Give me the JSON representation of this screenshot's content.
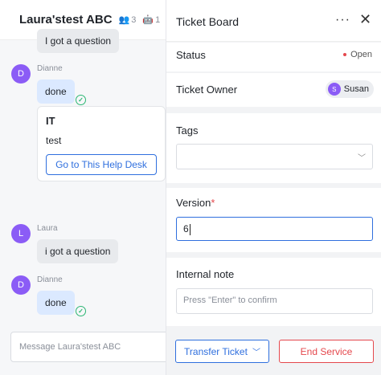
{
  "chat": {
    "title": "Laura'stest ABC",
    "members_count": "3",
    "bots_count": "1",
    "messages": [
      {
        "sender": "",
        "text": "I got a question"
      },
      {
        "sender": "Dianne",
        "initial": "D",
        "text": "done"
      },
      {
        "card_title": "IT",
        "card_body": "test",
        "card_button": "Go to This Help Desk"
      },
      {
        "sender": "Laura",
        "initial": "L",
        "text": "i got a question"
      },
      {
        "sender": "Dianne",
        "initial": "D",
        "text": "done"
      }
    ],
    "input_placeholder": "Message Laura'stest ABC"
  },
  "ticket": {
    "title": "Ticket Board",
    "status_label": "Status",
    "status_value": "Open",
    "owner_label": "Ticket Owner",
    "owner_initial": "S",
    "owner_name": "Susan",
    "tags_label": "Tags",
    "version_label": "Version",
    "version_required": "*",
    "version_value": "6",
    "note_label": "Internal note",
    "note_placeholder": "Press \"Enter\" to confirm",
    "transfer_label": "Transfer Ticket",
    "end_label": "End Service"
  },
  "colors": {
    "accent": "#2f6fde",
    "danger": "#e5484d",
    "avatar": "#8b5cf6",
    "success": "#2bb673"
  }
}
